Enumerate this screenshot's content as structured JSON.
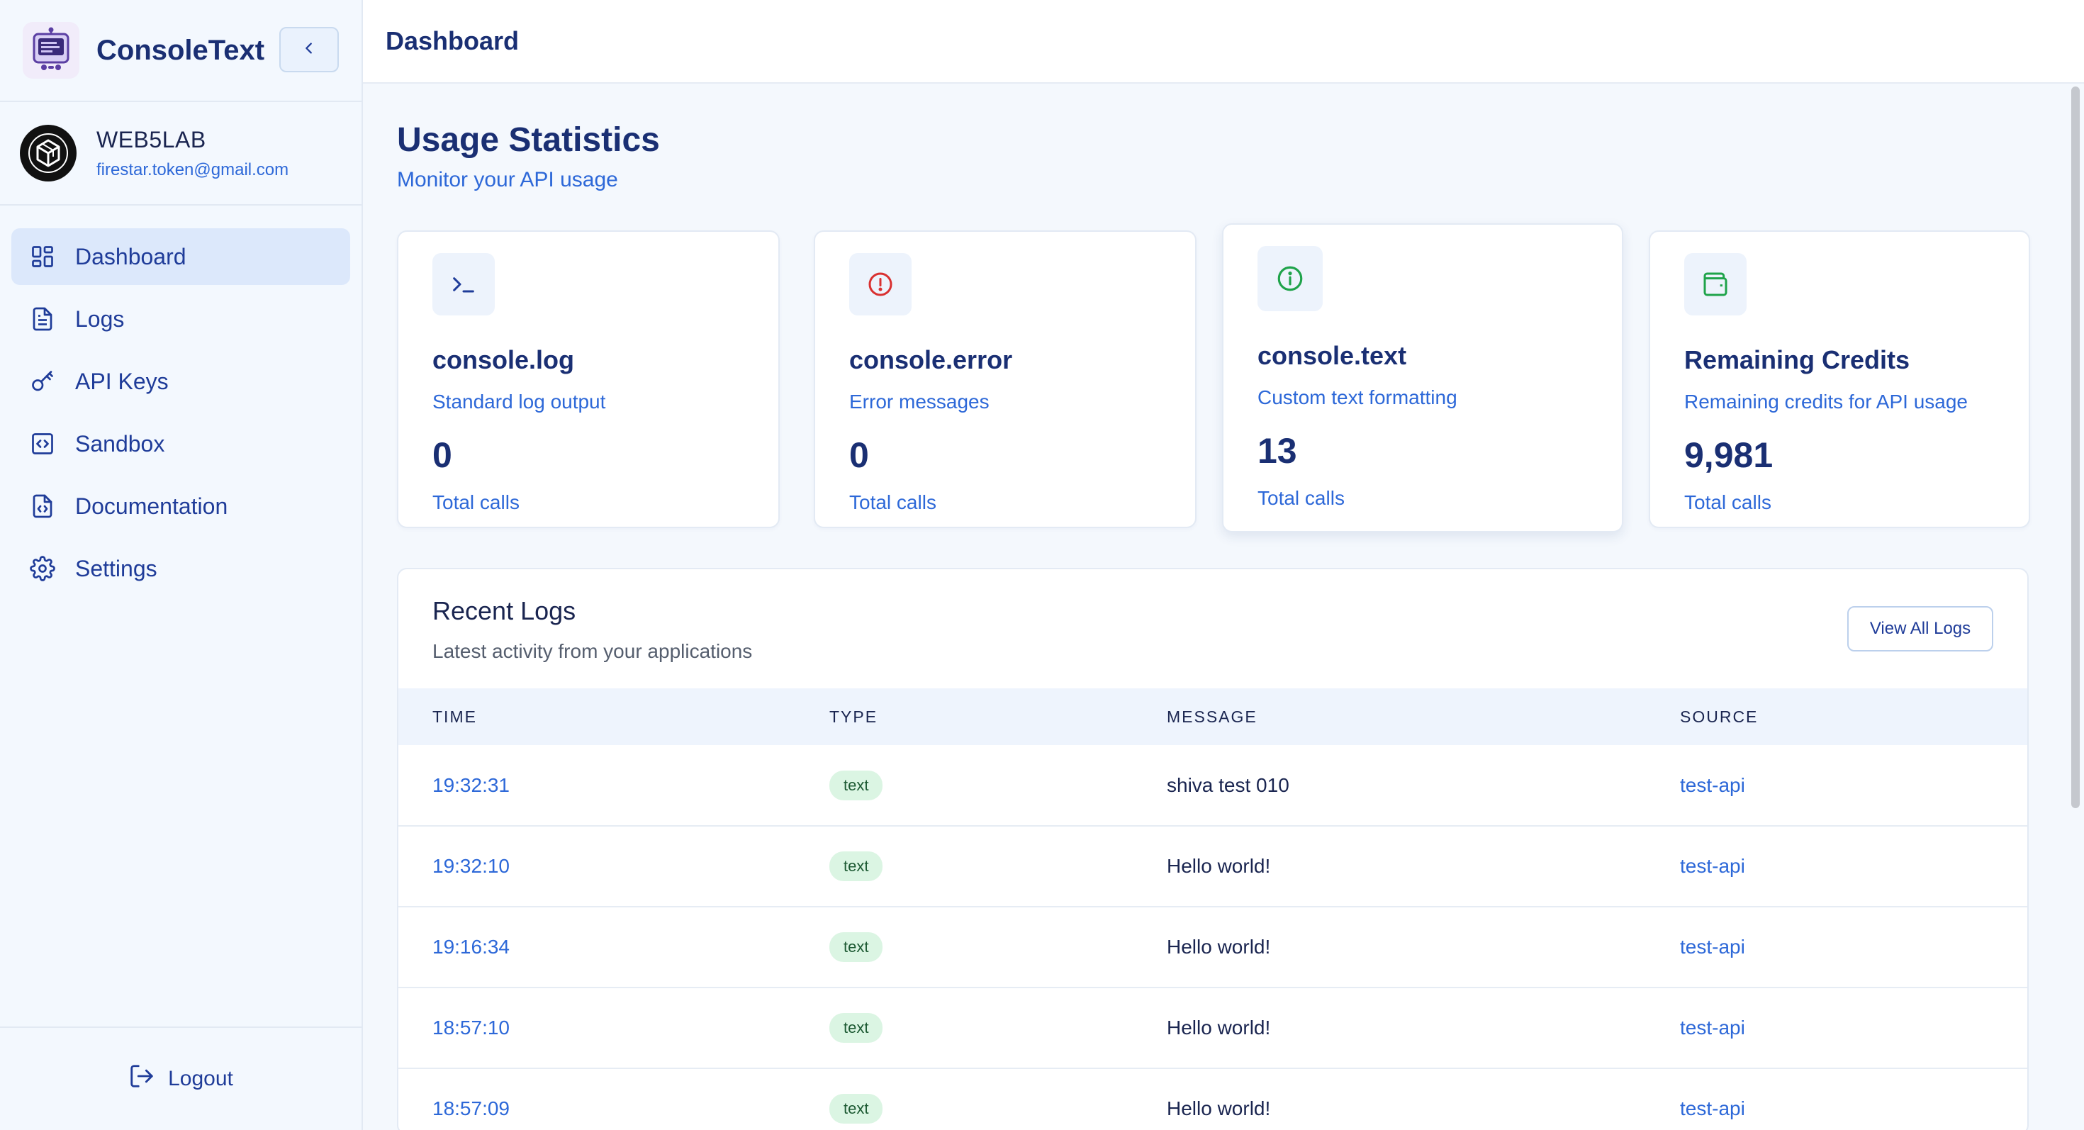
{
  "brand": {
    "name": "ConsoleText"
  },
  "user": {
    "name": "WEB5LAB",
    "email": "firestar.token@gmail.com"
  },
  "nav": {
    "items": [
      {
        "label": "Dashboard",
        "icon": "dashboard-icon",
        "active": true
      },
      {
        "label": "Logs",
        "icon": "file-text-icon"
      },
      {
        "label": "API Keys",
        "icon": "key-icon"
      },
      {
        "label": "Sandbox",
        "icon": "code-square-icon"
      },
      {
        "label": "Documentation",
        "icon": "file-code-icon"
      },
      {
        "label": "Settings",
        "icon": "gear-icon"
      }
    ],
    "logout": "Logout"
  },
  "topbar": {
    "title": "Dashboard"
  },
  "page": {
    "title": "Usage Statistics",
    "subtitle": "Monitor your API usage"
  },
  "cards": [
    {
      "name": "console.log",
      "desc": "Standard log output",
      "value": "0",
      "calls": "Total calls",
      "icon": "terminal-icon",
      "color": "#1f3c99"
    },
    {
      "name": "console.error",
      "desc": "Error messages",
      "value": "0",
      "calls": "Total calls",
      "icon": "alert-circle-icon",
      "color": "#d93030"
    },
    {
      "name": "console.text",
      "desc": "Custom text formatting",
      "value": "13",
      "calls": "Total calls",
      "icon": "info-icon",
      "color": "#1fa34a"
    },
    {
      "name": "Remaining Credits",
      "desc": "Remaining credits for API usage",
      "value": "9,981",
      "calls": "Total calls",
      "icon": "wallet-icon",
      "color": "#1fa34a"
    }
  ],
  "logs": {
    "title": "Recent Logs",
    "subtitle": "Latest activity from your applications",
    "view_all": "View All Logs",
    "columns": [
      "TIME",
      "TYPE",
      "MESSAGE",
      "SOURCE"
    ],
    "rows": [
      {
        "time": "19:32:31",
        "type": "text",
        "message": "shiva test 010",
        "source": "test-api"
      },
      {
        "time": "19:32:10",
        "type": "text",
        "message": "Hello world!",
        "source": "test-api"
      },
      {
        "time": "19:16:34",
        "type": "text",
        "message": "Hello world!",
        "source": "test-api"
      },
      {
        "time": "18:57:10",
        "type": "text",
        "message": "Hello world!",
        "source": "test-api"
      },
      {
        "time": "18:57:09",
        "type": "text",
        "message": "Hello world!",
        "source": "test-api"
      }
    ]
  },
  "colors": {
    "accent": "#2d68d8",
    "primary": "#1a2f73",
    "badge_bg": "#dbf5e3"
  }
}
